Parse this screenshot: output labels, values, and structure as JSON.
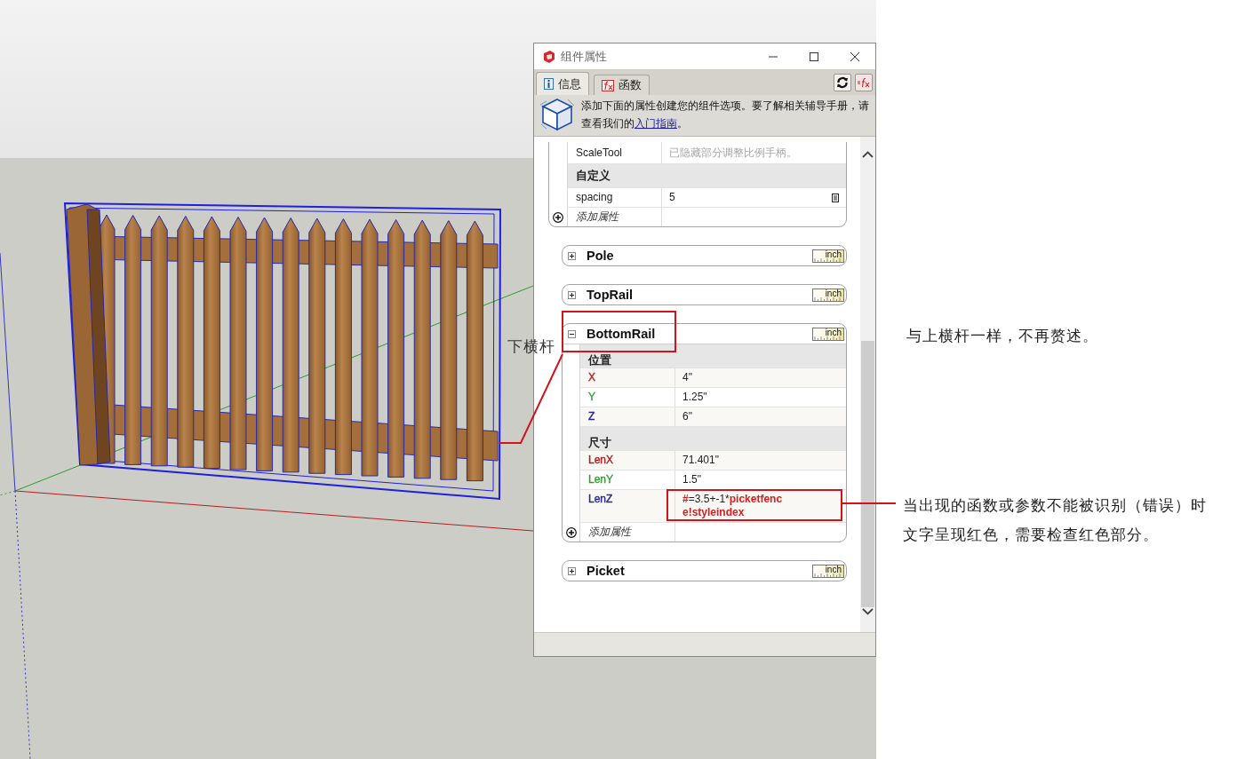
{
  "window": {
    "title": "组件属性"
  },
  "tabs": [
    {
      "label": "信息",
      "selected": true
    },
    {
      "label": "函数",
      "selected": false
    }
  ],
  "banner": {
    "text": "添加下面的属性创建您的组件选项。要了解相关辅导手册，请查看我们的",
    "link": "入门指南",
    "text_end": "。"
  },
  "top_group": {
    "rows": [
      {
        "kind": "hint",
        "label": "ScaleTool",
        "value": "已隐藏部分调整比例手柄。"
      },
      {
        "kind": "section",
        "label": "自定义"
      },
      {
        "kind": "user",
        "label": "spacing",
        "value": "5"
      }
    ],
    "add_label": "添加属性"
  },
  "groups": [
    {
      "name": "Pole",
      "expanded": false,
      "unit": "inch"
    },
    {
      "name": "TopRail",
      "expanded": false,
      "unit": "inch"
    },
    {
      "name": "BottomRail",
      "expanded": true,
      "unit": "inch",
      "rows": [
        {
          "kind": "section",
          "label": "位置"
        },
        {
          "kind": "attribute",
          "label": "X",
          "color": "#b22222",
          "value": "4\""
        },
        {
          "kind": "attribute",
          "label": "Y",
          "color": "#3a9a3a",
          "value": "1.25\""
        },
        {
          "kind": "attribute",
          "label": "Z",
          "color": "#2b2b8c",
          "value": "6\""
        },
        {
          "kind": "section",
          "label": "尺寸"
        },
        {
          "kind": "attribute",
          "label": "LenX",
          "color": "#b22222",
          "value": "71.401\""
        },
        {
          "kind": "attribute",
          "label": "LenY",
          "color": "#3a9a3a",
          "value": "1.5\""
        },
        {
          "kind": "attribute",
          "label": "LenZ",
          "color": "#2b2b8c",
          "value_parts": [
            {
              "text": "#",
              "error": true
            },
            {
              "text": "=3.5+-1*",
              "error": false
            },
            {
              "text": "picketfence!styleindex",
              "error": true
            }
          ]
        }
      ],
      "add_label": "添加属性"
    },
    {
      "name": "Picket",
      "expanded": false,
      "unit": "inch"
    }
  ],
  "annotations": {
    "callout_label": "下横杆",
    "note_same": "与上横杆一样，不再赘述。",
    "note_error": "当出现的函数或参数不能被识别（错误）时文字呈现红色，需要检查红色部分。"
  }
}
